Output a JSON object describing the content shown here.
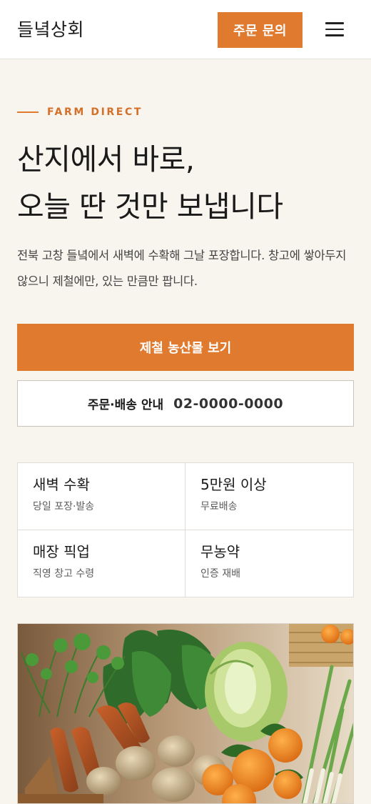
{
  "header": {
    "logo": "들녘상회",
    "order_button": "주문 문의",
    "menu_icon": "hamburger-menu-icon"
  },
  "hero": {
    "eyebrow": "FARM DIRECT",
    "headline_line1": "산지에서 바로,",
    "headline_line2": "오늘 딴 것만 보냅니다",
    "description": "전북 고창 들녘에서 새벽에 수확해 그날 포장합니다. 창고에 쌓아두지 않으니 제철에만, 있는 만큼만 팝니다."
  },
  "cta": {
    "primary": "제철 농산물 보기",
    "secondary_label": "주문·배송 안내",
    "secondary_phone": "02-0000-0000"
  },
  "features": [
    {
      "title": "새벽 수확",
      "sub": "당일 포장·발송"
    },
    {
      "title": "5만원 이상",
      "sub": "무료배송"
    },
    {
      "title": "매장 픽업",
      "sub": "직영 창고 수령"
    },
    {
      "title": "무농약",
      "sub": "인증 재배"
    }
  ],
  "colors": {
    "accent": "#e07a2e",
    "background": "#f8f4ee",
    "text": "#1a1a1a"
  }
}
